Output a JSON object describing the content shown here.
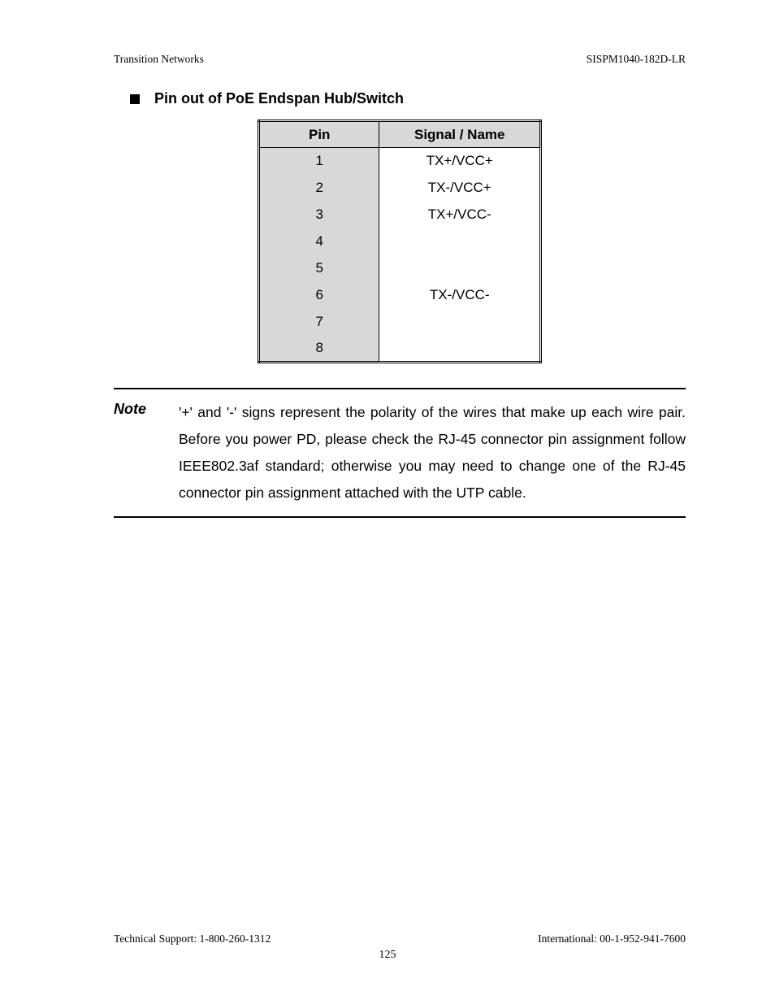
{
  "header": {
    "left": "Transition Networks",
    "right": "SISPM1040-182D-LR"
  },
  "section": {
    "title": "Pin out of PoE Endspan Hub/Switch"
  },
  "table": {
    "headers": {
      "col1": "Pin",
      "col2": "Signal / Name"
    },
    "rows": [
      {
        "pin": "1",
        "signal": "TX+/VCC+"
      },
      {
        "pin": "2",
        "signal": "TX-/VCC+"
      },
      {
        "pin": "3",
        "signal": "TX+/VCC-"
      },
      {
        "pin": "4",
        "signal": ""
      },
      {
        "pin": "5",
        "signal": ""
      },
      {
        "pin": "6",
        "signal": "TX-/VCC-"
      },
      {
        "pin": "7",
        "signal": ""
      },
      {
        "pin": "8",
        "signal": ""
      }
    ]
  },
  "note": {
    "label": "Note",
    "text": "'+' and '-' signs represent the polarity of the wires that make up each wire pair. Before you power PD, please check the RJ-45 connector pin assignment follow IEEE802.3af standard; otherwise you may need to change one of the RJ-45 connector pin assignment attached with the UTP cable."
  },
  "footer": {
    "left": "Technical Support: 1-800-260-1312",
    "right": "International: 00-1-952-941-7600",
    "page": "125"
  }
}
